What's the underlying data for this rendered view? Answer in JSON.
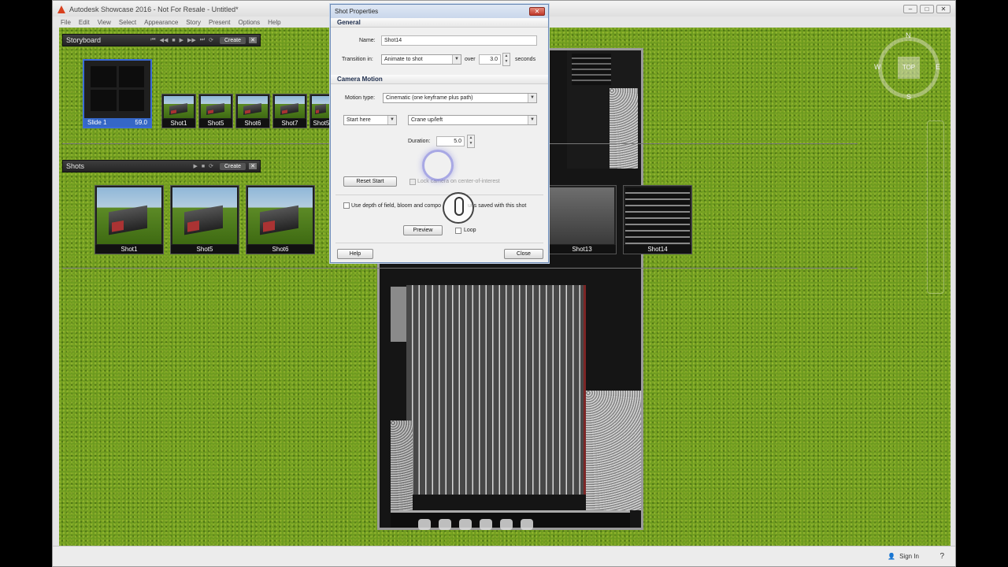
{
  "app": {
    "title": "Autodesk Showcase 2016 - Not For Resale - Untitled*",
    "menu": [
      "File",
      "Edit",
      "View",
      "Select",
      "Appearance",
      "Story",
      "Present",
      "Options",
      "Help"
    ],
    "signin": "Sign In",
    "help": "?"
  },
  "storyboard": {
    "title": "Storyboard",
    "create": "Create",
    "slide": {
      "label": "Slide 1",
      "duration": "59.0"
    },
    "shots": [
      "Shot1",
      "Shot5",
      "Shot6",
      "Shot7",
      "Shot5"
    ]
  },
  "shots_panel": {
    "title": "Shots",
    "create": "Create",
    "thumbs": [
      "Shot1",
      "Shot5",
      "Shot6",
      "Shot13",
      "Shot14"
    ]
  },
  "compass": {
    "top": "TOP",
    "n": "N",
    "s": "S",
    "e": "E",
    "w": "W"
  },
  "dialog": {
    "title": "Shot Properties",
    "close_x": "✕",
    "general": "General",
    "name_label": "Name:",
    "name_value": "Shot14",
    "transition_label": "Transition in:",
    "transition_value": "Animate to shot",
    "over_label": "over",
    "over_value": "3.0",
    "seconds_label": "seconds",
    "camera_motion": "Camera Motion",
    "motion_type_label": "Motion type:",
    "motion_type_value": "Cinematic (one keyframe plus path)",
    "start_value": "Start here",
    "crane_value": "Crane up/left",
    "duration_label": "Duration:",
    "duration_value": "5.0",
    "reset_start": "Reset Start",
    "lock_label": "Lock camera on center-of-interest",
    "dof_label": "Use depth of field, bloom and compo",
    "dof_label2": "ues saved with this shot",
    "preview": "Preview",
    "loop": "Loop",
    "help": "Help",
    "close": "Close"
  }
}
